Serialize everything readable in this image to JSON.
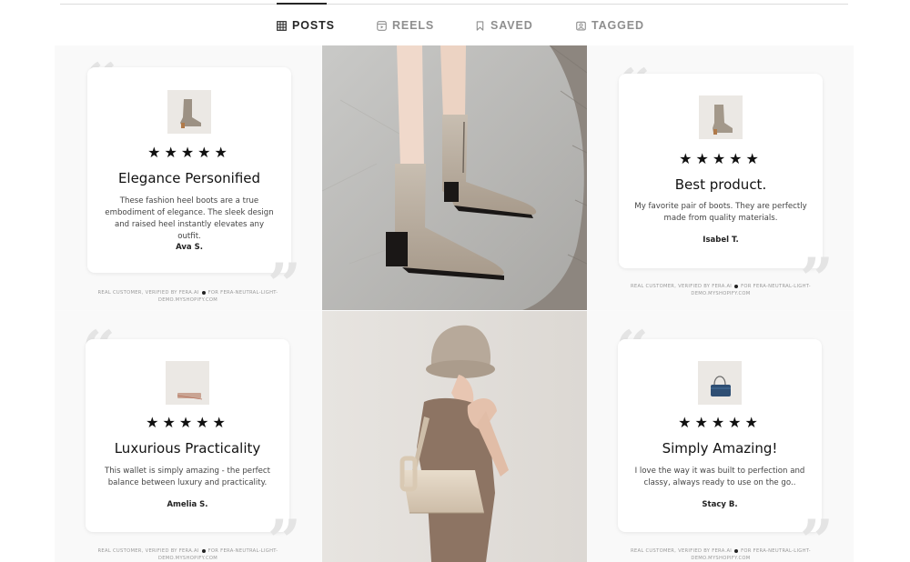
{
  "tabs": [
    {
      "label": "POSTS",
      "icon": "grid-icon",
      "active": true
    },
    {
      "label": "REELS",
      "icon": "reels-icon",
      "active": false
    },
    {
      "label": "SAVED",
      "icon": "bookmark-icon",
      "active": false
    },
    {
      "label": "TAGGED",
      "icon": "tagged-icon",
      "active": false
    }
  ],
  "colors": {
    "active_tab": "#262626",
    "inactive_tab": "#8e8e8e",
    "quote_mark": "#e4e4e4"
  },
  "reviews": [
    {
      "stars": "★★★★★",
      "title": "Elegance Personified",
      "body": "These fashion heel boots are a true embodiment of elegance. The sleek design and raised heel instantly elevates any outfit.",
      "author": "Ava S.",
      "footnote_left": "REAL CUSTOMER, VERIFIED BY FERA.AI",
      "footnote_right": "FOR FERA-NEUTRAL-LIGHT-DEMO.MYSHOPIFY.COM",
      "product_icon": "boot-icon"
    },
    {
      "stars": "★★★★★",
      "title": "Best product.",
      "body": "My favorite pair of boots. They are perfectly made from quality materials.",
      "author": "Isabel T.",
      "footnote_left": "REAL CUSTOMER, VERIFIED BY FERA.AI",
      "footnote_right": "FOR FERA-NEUTRAL-LIGHT-DEMO.MYSHOPIFY.COM",
      "product_icon": "boot-icon"
    },
    {
      "stars": "★★★★★",
      "title": "Luxurious Practicality",
      "body": "This wallet is simply amazing - the perfect balance between luxury and practicality.",
      "author": "Amelia S.",
      "footnote_left": "REAL CUSTOMER, VERIFIED BY FERA.AI",
      "footnote_right": "FOR FERA-NEUTRAL-LIGHT-DEMO.MYSHOPIFY.COM",
      "product_icon": "wallet-icon"
    },
    {
      "stars": "★★★★★",
      "title": "Simply Amazing!",
      "body": "I love the way it was built to perfection and classy, always ready to use on the go..",
      "author": "Stacy B.",
      "footnote_left": "REAL CUSTOMER, VERIFIED BY FERA.AI",
      "footnote_right": "FOR FERA-NEUTRAL-LIGHT-DEMO.MYSHOPIFY.COM",
      "product_icon": "handbag-icon"
    }
  ],
  "photos": [
    {
      "subject": "ankle-boots-photo"
    },
    {
      "subject": "model-with-handbag-photo"
    }
  ]
}
